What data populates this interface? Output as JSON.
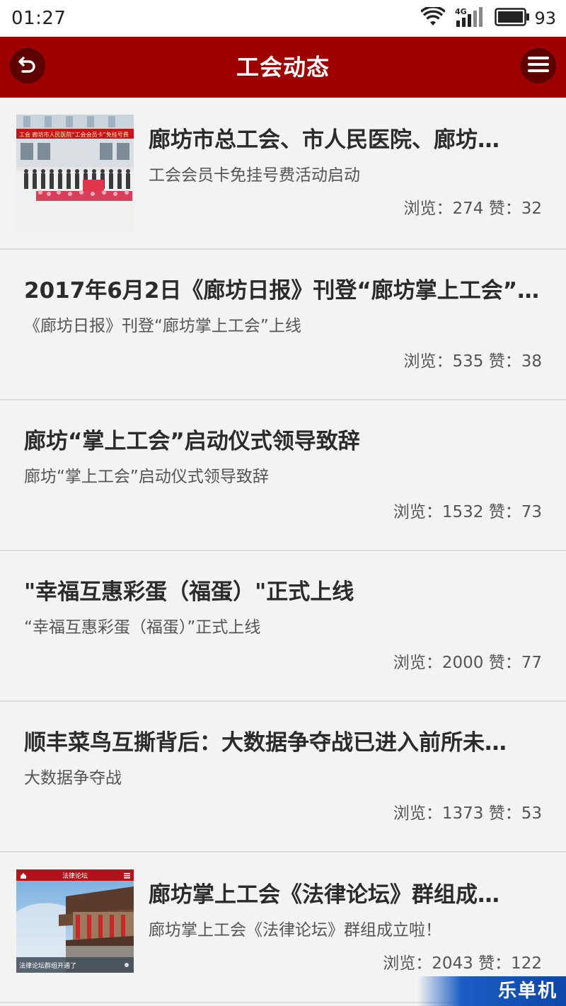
{
  "status_bar": {
    "time": "01:27",
    "network": "4G",
    "battery": "93"
  },
  "header": {
    "title": "工会动态",
    "back_icon": "back-arrow-icon",
    "menu_icon": "hamburger-menu-icon"
  },
  "news": [
    {
      "title": "廊坊市总工会、市人民医院、廊坊…",
      "subtitle": "工会会员卡免挂号费活动启动",
      "stats": "浏览：274 赞：32",
      "has_thumb": true,
      "thumb_banner": "工会 廊坊市人民医院“工会会员卡”免挂号费"
    },
    {
      "title": "2017年6月2日《廊坊日报》刊登“廊坊掌上工会”…",
      "subtitle": "《廊坊日报》刊登“廊坊掌上工会”上线",
      "stats": "浏览：535 赞：38",
      "has_thumb": false
    },
    {
      "title": "廊坊“掌上工会”启动仪式领导致辞",
      "subtitle": "廊坊“掌上工会”启动仪式领导致辞",
      "stats": "浏览：1532 赞：73",
      "has_thumb": false
    },
    {
      "title": "\"幸福互惠彩蛋（福蛋）\"正式上线",
      "subtitle": "“幸福互惠彩蛋（福蛋）”正式上线",
      "stats": "浏览：2000 赞：77",
      "has_thumb": false
    },
    {
      "title": "顺丰菜鸟互撕背后：大数据争夺战已进入前所未…",
      "subtitle": "大数据争夺战",
      "stats": "浏览：1373 赞：53",
      "has_thumb": false
    },
    {
      "title": "廊坊掌上工会《法律论坛》群组成…",
      "subtitle": "廊坊掌上工会《法律论坛》群组成立啦！",
      "stats": "浏览：2043 赞：122",
      "has_thumb": true,
      "thumb_header": "法律论坛",
      "thumb_caption": "法律论坛群组开通了"
    }
  ],
  "watermark": "乐单机",
  "colors": {
    "header_bg": "#9e0000",
    "header_btn_bg": "#5e0000",
    "page_bg": "#f3f3f3",
    "divider": "#dcdcdc"
  }
}
